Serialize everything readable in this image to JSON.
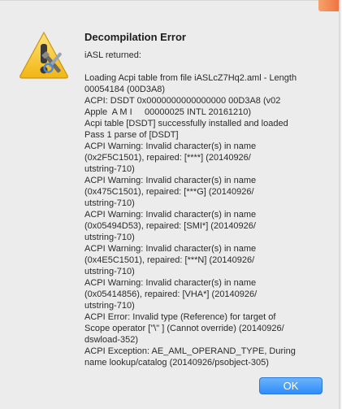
{
  "dialog": {
    "title": "Decompilation Error",
    "subtitle": "iASL returned:",
    "icon": "warning-triangle-with-tools",
    "message_lines": [
      "Loading Acpi table from file iASLcZ7Hq2.aml - Length",
      "00054184 (00D3A8)",
      "ACPI: DSDT 0x0000000000000000 00D3A8 (v02",
      "Apple  A M I     00000025 INTL 20161210)",
      "Acpi table [DSDT] successfully installed and loaded",
      "Pass 1 parse of [DSDT]",
      "ACPI Warning: Invalid character(s) in name",
      "(0x2F5C1501), repaired: [****] (20140926/",
      "utstring-710)",
      "ACPI Warning: Invalid character(s) in name",
      "(0x475C1501), repaired: [***G] (20140926/",
      "utstring-710)",
      "ACPI Warning: Invalid character(s) in name",
      "(0x05494D53), repaired: [SMI*] (20140926/",
      "utstring-710)",
      "ACPI Warning: Invalid character(s) in name",
      "(0x4E5C1501), repaired: [***N] (20140926/",
      "utstring-710)",
      "ACPI Warning: Invalid character(s) in name",
      "(0x05414856), repaired: [VHA*] (20140926/",
      "utstring-710)",
      "ACPI Error: Invalid type (Reference) for target of",
      "Scope operator [\"\\\" ] (Cannot override) (20140926/",
      "dswload-352)",
      "ACPI Exception: AE_AML_OPERAND_TYPE, During",
      "name lookup/catalog (20140926/psobject-305)"
    ],
    "ok_label": "OK"
  },
  "colors": {
    "dialog_bg": "#ececec",
    "button_blue": "#2f8dfb",
    "warning_yellow": "#f7c531"
  }
}
